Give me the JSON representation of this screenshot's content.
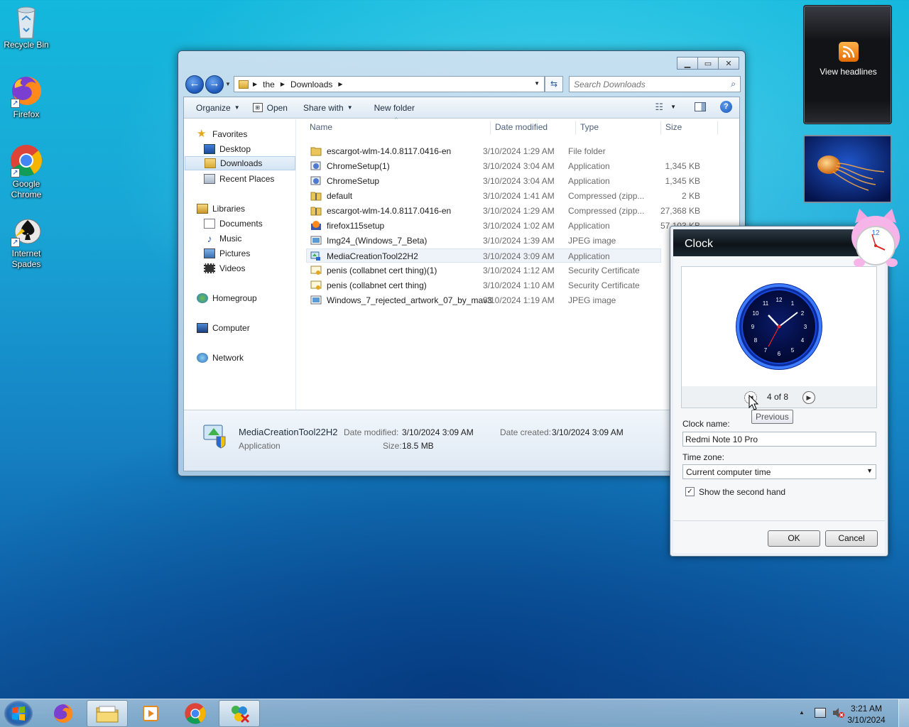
{
  "desktop": {
    "icons": [
      {
        "label": "Recycle Bin"
      },
      {
        "label": "Firefox"
      },
      {
        "label": "Google Chrome"
      },
      {
        "label": "Internet Spades"
      }
    ]
  },
  "explorer": {
    "breadcrumb": [
      "the",
      "Downloads"
    ],
    "search_placeholder": "Search Downloads",
    "toolbar": {
      "organize": "Organize",
      "open": "Open",
      "share_with": "Share with",
      "new_folder": "New folder"
    },
    "nav": {
      "favorites": "Favorites",
      "desktop": "Desktop",
      "downloads": "Downloads",
      "recent_places": "Recent Places",
      "libraries": "Libraries",
      "documents": "Documents",
      "music": "Music",
      "pictures": "Pictures",
      "videos": "Videos",
      "homegroup": "Homegroup",
      "computer": "Computer",
      "network": "Network"
    },
    "columns": {
      "name": "Name",
      "date": "Date modified",
      "type": "Type",
      "size": "Size"
    },
    "files": [
      {
        "name": "escargot-wlm-14.0.8117.0416-en",
        "date": "3/10/2024 1:29 AM",
        "type": "File folder",
        "size": "",
        "icon": "folder-icon"
      },
      {
        "name": "ChromeSetup(1)",
        "date": "3/10/2024 3:04 AM",
        "type": "Application",
        "size": "1,345 KB",
        "icon": "setup-icon"
      },
      {
        "name": "ChromeSetup",
        "date": "3/10/2024 3:04 AM",
        "type": "Application",
        "size": "1,345 KB",
        "icon": "setup-icon"
      },
      {
        "name": "default",
        "date": "3/10/2024 1:41 AM",
        "type": "Compressed (zipp...",
        "size": "2 KB",
        "icon": "zip-folder-icon"
      },
      {
        "name": "escargot-wlm-14.0.8117.0416-en",
        "date": "3/10/2024 1:29 AM",
        "type": "Compressed (zipp...",
        "size": "27,368 KB",
        "icon": "zip-folder-icon"
      },
      {
        "name": "firefox115setup",
        "date": "3/10/2024 1:02 AM",
        "type": "Application",
        "size": "57,103 KB",
        "icon": "firefox-setup-icon"
      },
      {
        "name": "Img24_(Windows_7_Beta)",
        "date": "3/10/2024 1:39 AM",
        "type": "JPEG image",
        "size": "",
        "icon": "image-icon"
      },
      {
        "name": "MediaCreationTool22H2",
        "date": "3/10/2024 3:09 AM",
        "type": "Application",
        "size": "",
        "icon": "media-tool-icon"
      },
      {
        "name": "penis (collabnet cert thing)(1)",
        "date": "3/10/2024 1:12 AM",
        "type": "Security Certificate",
        "size": "",
        "icon": "certificate-icon"
      },
      {
        "name": "penis (collabnet cert thing)",
        "date": "3/10/2024 1:10 AM",
        "type": "Security Certificate",
        "size": "",
        "icon": "certificate-icon"
      },
      {
        "name": "Windows_7_rejected_artwork_07_by_mav3",
        "date": "3/10/2024 1:19 AM",
        "type": "JPEG image",
        "size": "",
        "icon": "image-icon"
      }
    ],
    "details": {
      "name": "MediaCreationTool22H2",
      "kind": "Application",
      "date_modified_label": "Date modified:",
      "date_modified": "3/10/2024 3:09 AM",
      "date_created_label": "Date created:",
      "date_created": "3/10/2024 3:09 AM",
      "size_label": "Size:",
      "size": "18.5 MB"
    }
  },
  "gadgets": {
    "rss_label": "View headlines"
  },
  "clock_dialog": {
    "title": "Clock",
    "pager": "4 of 8",
    "tooltip": "Previous",
    "clock_name_label": "Clock name:",
    "clock_name_value": "Redmi Note 10 Pro",
    "time_zone_label": "Time zone:",
    "time_zone_value": "Current computer time",
    "second_hand_label": "Show the second hand",
    "second_hand_checked": true,
    "ok": "OK",
    "cancel": "Cancel"
  },
  "taskbar": {
    "time": "3:21 AM",
    "date": "3/10/2024"
  },
  "colors": {
    "desktop_top": "#14b8dc",
    "desktop_bottom": "#0c4d92",
    "selection": "#d4e4f4"
  }
}
